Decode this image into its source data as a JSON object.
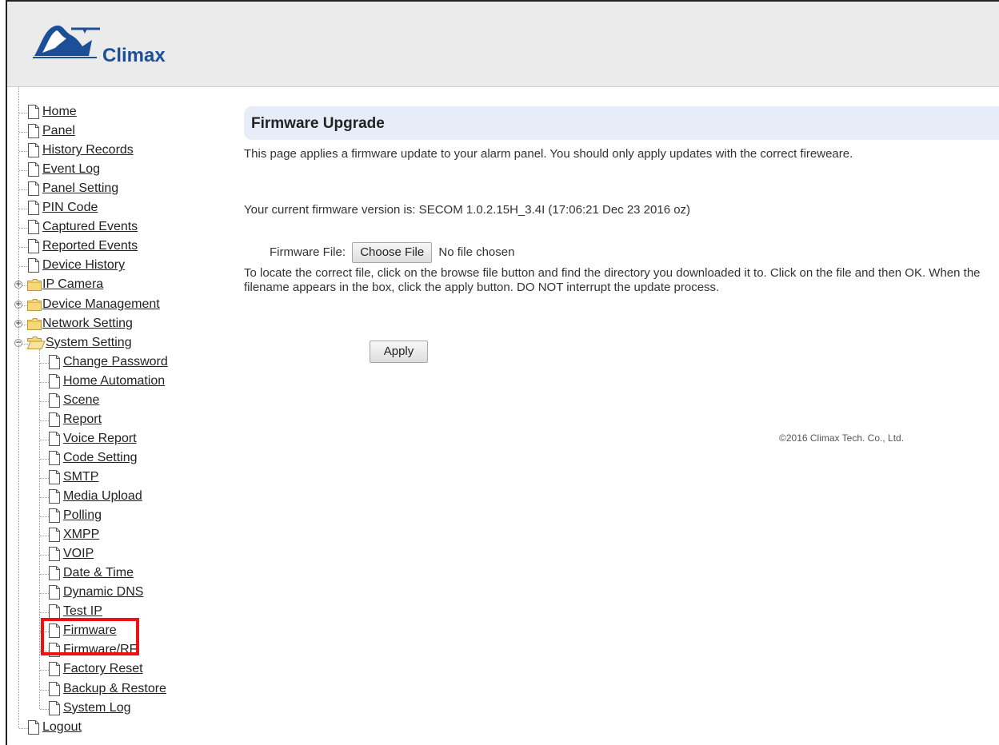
{
  "brand": {
    "name": "Climax"
  },
  "nav": {
    "items": [
      {
        "label": "Home"
      },
      {
        "label": "Panel"
      },
      {
        "label": "History Records"
      },
      {
        "label": "Event Log"
      },
      {
        "label": "Panel Setting"
      },
      {
        "label": "PIN Code"
      },
      {
        "label": "Captured Events"
      },
      {
        "label": "Reported Events"
      },
      {
        "label": "Device History"
      },
      {
        "label": "IP Camera",
        "folder": true,
        "expanded": false
      },
      {
        "label": "Device Management",
        "folder": true,
        "expanded": false
      },
      {
        "label": "Network Setting",
        "folder": true,
        "expanded": false
      },
      {
        "label": "System Setting",
        "folder": true,
        "expanded": true,
        "children": [
          {
            "label": "Change Password"
          },
          {
            "label": "Home Automation"
          },
          {
            "label": "Scene"
          },
          {
            "label": "Report"
          },
          {
            "label": "Voice Report"
          },
          {
            "label": "Code Setting"
          },
          {
            "label": "SMTP"
          },
          {
            "label": "Media Upload"
          },
          {
            "label": "Polling"
          },
          {
            "label": "XMPP"
          },
          {
            "label": "VOIP"
          },
          {
            "label": "Date & Time"
          },
          {
            "label": "Dynamic DNS"
          },
          {
            "label": "Test IP"
          },
          {
            "label": "Firmware",
            "highlighted": true
          },
          {
            "label": "Firmware/RF"
          },
          {
            "label": "Factory Reset"
          },
          {
            "label": "Backup & Restore"
          },
          {
            "label": "System Log"
          }
        ]
      },
      {
        "label": "Logout"
      }
    ]
  },
  "main": {
    "title": "Firmware Upgrade",
    "intro": "This page applies a firmware update to your alarm panel. You should only apply updates with the correct fireweare.",
    "current_version": "Your current firmware version is: SECOM 1.0.2.15H_3.4I (17:06:21 Dec 23 2016 oz)",
    "file_label": "Firmware File:",
    "choose_file_label": "Choose File",
    "no_file_text": "No file chosen",
    "instructions": "To locate the correct file, click on the browse file button and find the directory you downloaded it to. Click on the file and then OK. When the filename appears in the box, click the apply button. DO NOT interrupt the update process.",
    "apply_label": "Apply",
    "copyright": "©2016 Climax Tech. Co., Ltd."
  },
  "colors": {
    "header_bg": "#ebebeb",
    "title_bar_bg": "#e6ecf8",
    "brand_blue": "#1c4f97",
    "highlight": "#ee1111"
  },
  "icons": [
    "climax-logo",
    "page-icon",
    "folder-icon",
    "folder-open-icon",
    "plus-icon",
    "minus-icon"
  ]
}
